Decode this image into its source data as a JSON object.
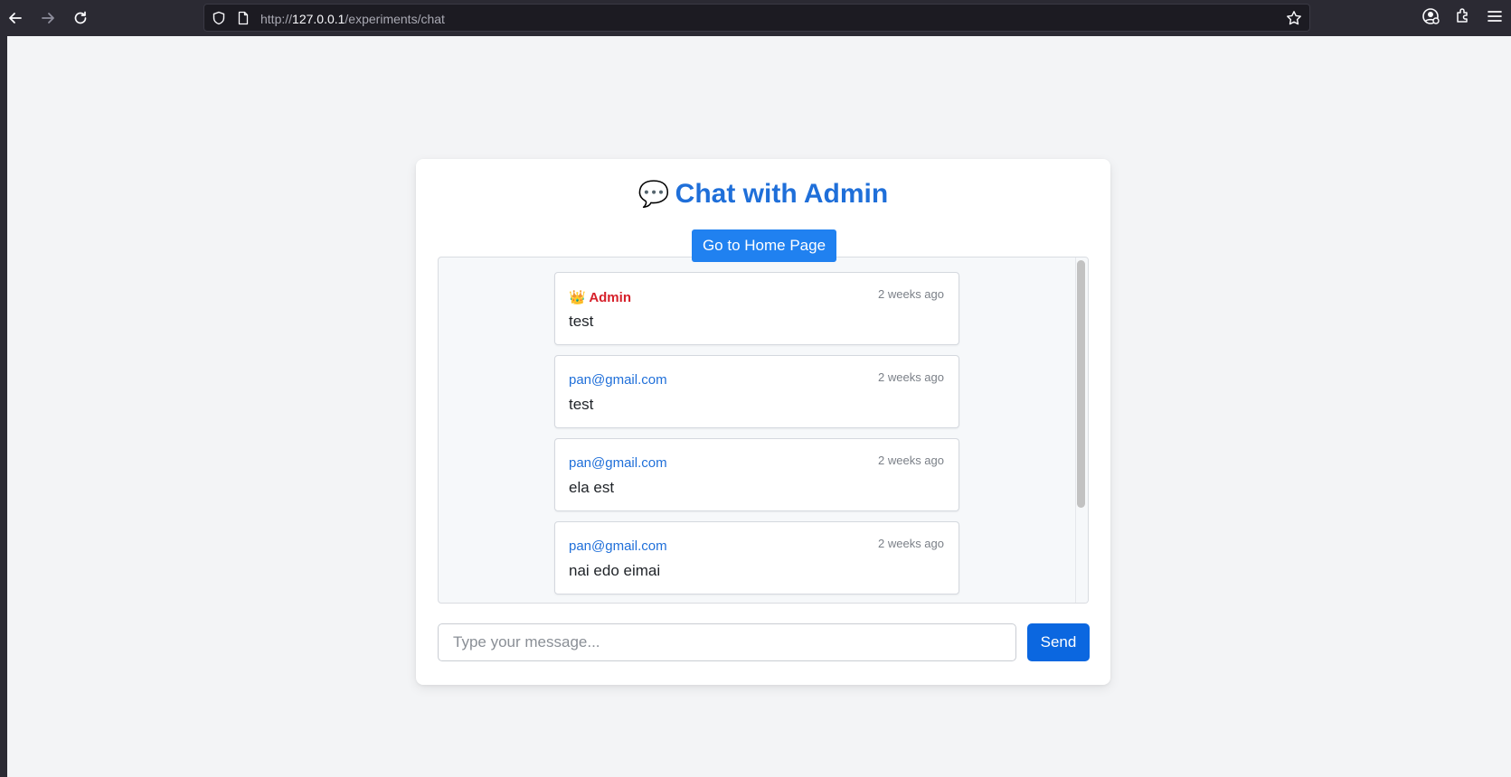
{
  "browser": {
    "url_prefix": "http://",
    "url_host": "127.0.0.1",
    "url_path": "/experiments/chat"
  },
  "page": {
    "title_emoji": "💬",
    "title": "Chat with Admin",
    "home_button": "Go to Home Page",
    "input_placeholder": "Type your message...",
    "send_button": "Send"
  },
  "messages": [
    {
      "sender_emoji": "👑",
      "sender": "Admin",
      "time": "2 weeks ago",
      "text": "test"
    },
    {
      "sender": "pan@gmail.com",
      "time": "2 weeks ago",
      "text": "test"
    },
    {
      "sender": "pan@gmail.com",
      "time": "2 weeks ago",
      "text": "ela est"
    },
    {
      "sender": "pan@gmail.com",
      "time": "2 weeks ago",
      "text": "nai edo eimai"
    }
  ],
  "colors": {
    "accent": "#1f6fd9",
    "admin": "#d6202a",
    "send": "#0b67e0"
  }
}
